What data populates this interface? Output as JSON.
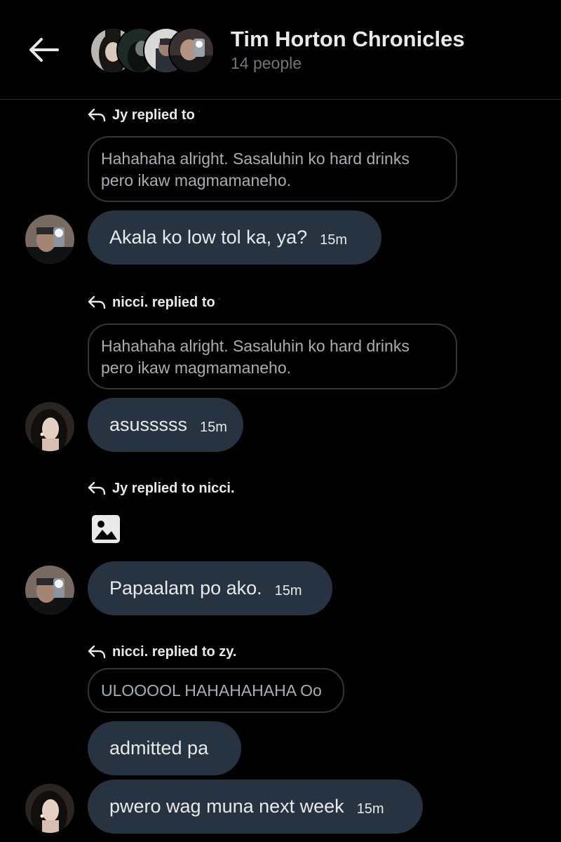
{
  "header": {
    "title": "Tim Horton Chronicles",
    "subtitle": "14 people"
  },
  "messages": [
    {
      "reply_label": "Jy replied to",
      "reply_target_dot": "·",
      "quote_lines": [
        "Hahahaha alright. Sasaluhin ko hard drinks",
        "pero ikaw magmamaneho."
      ],
      "text": "Akala ko low tol ka, ya?",
      "time": "15m"
    },
    {
      "reply_label": "nicci. replied to",
      "reply_target_dot": "·",
      "quote_lines": [
        "Hahahaha alright. Sasaluhin ko hard drinks",
        "pero ikaw magmamaneho."
      ],
      "text": "asusssss",
      "time": "15m"
    },
    {
      "reply_label": "Jy replied to nicci.",
      "attachment_icon": "image-icon",
      "text": "Papaalam po ako.",
      "time": "15m"
    },
    {
      "reply_label": "nicci. replied to zy.",
      "quote_lines": [
        "ULOOOOL HAHAHAHAHA Oo"
      ],
      "text": "admitted pa"
    },
    {
      "text": "pwero wag muna next week",
      "time": "15m"
    }
  ],
  "icons": {
    "back": "arrow-left-icon",
    "reply": "reply-arrow-icon",
    "image": "image-icon"
  },
  "colors": {
    "background": "#000000",
    "bubble": "#273340",
    "text": "#e7e9ea",
    "muted": "#71767b",
    "quote_border": "#333639",
    "divider": "#2f3336"
  }
}
